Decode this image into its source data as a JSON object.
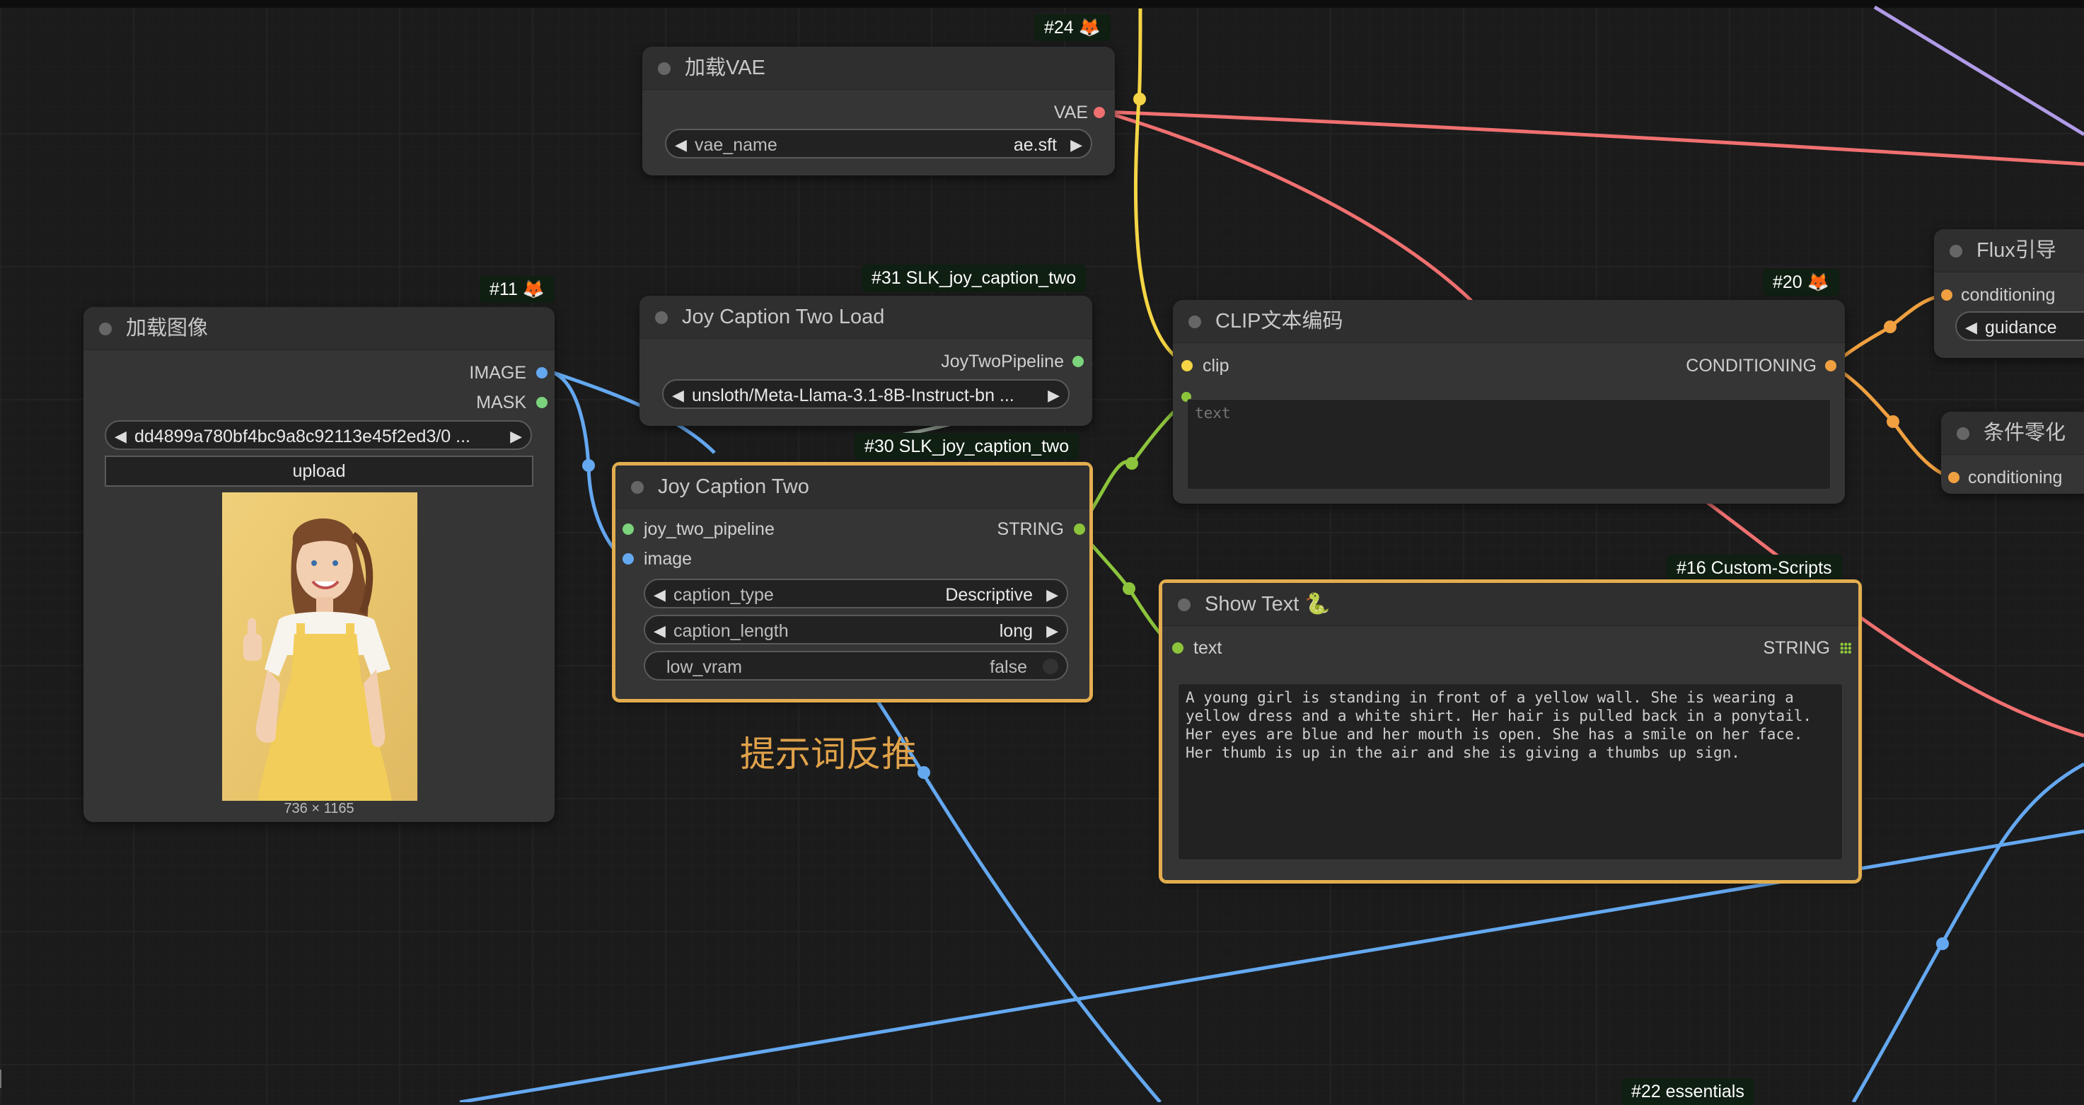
{
  "colors": {
    "image": "#64a8f0",
    "vae": "#f07070",
    "clip": "#f5d545",
    "conditioning": "#f0a040",
    "string": "#8cc43c",
    "mask": "#7bd37b",
    "pipeline": "#7bd37b",
    "latent": "#b09be8",
    "selected_outline": "#e3ad4f"
  },
  "badges": {
    "n24": "#24 🦊",
    "n11": "#11 🦊",
    "n31": "#31 SLK_joy_caption_two",
    "n30": "#30 SLK_joy_caption_two",
    "n20": "#20 🦊",
    "n16": "#16 Custom-Scripts",
    "n22": "#22 essentials"
  },
  "load_vae": {
    "title": "加载VAE",
    "output": "VAE",
    "widget_label": "vae_name",
    "widget_value": "ae.sft"
  },
  "load_image": {
    "title": "加载图像",
    "output_image": "IMAGE",
    "output_mask": "MASK",
    "file_value": "dd4899a780bf4bc9a8c92113e45f2ed3/0  ...",
    "upload_label": "upload",
    "dimensions": "736 × 1165"
  },
  "joy_load": {
    "title": "Joy Caption Two Load",
    "output": "JoyTwoPipeline",
    "model_value": "unsloth/Meta-Llama-3.1-8B-Instruct-bn ..."
  },
  "joy_two": {
    "title": "Joy Caption Two",
    "input_pipeline": "joy_two_pipeline",
    "input_image": "image",
    "output": "STRING",
    "caption_type_label": "caption_type",
    "caption_type_value": "Descriptive",
    "caption_length_label": "caption_length",
    "caption_length_value": "long",
    "low_vram_label": "low_vram",
    "low_vram_value": "false"
  },
  "annotation": "提示词反推",
  "clip_encode": {
    "title": "CLIP文本编码",
    "input": "clip",
    "output": "CONDITIONING",
    "placeholder": "text"
  },
  "show_text": {
    "title": "Show Text 🐍",
    "input": "text",
    "output": "STRING",
    "content": "A young girl is standing in front of a yellow wall. She is wearing a\nyellow dress and a white shirt. Her hair is pulled back in a ponytail.\nHer eyes are blue and her mouth is open. She has a smile on her face.\nHer thumb is up in the air and she is giving a thumbs up sign."
  },
  "flux_guidance": {
    "title": "Flux引导",
    "input": "conditioning",
    "widget_label": "guidance"
  },
  "cond_zero": {
    "title": "条件零化",
    "input": "conditioning"
  }
}
